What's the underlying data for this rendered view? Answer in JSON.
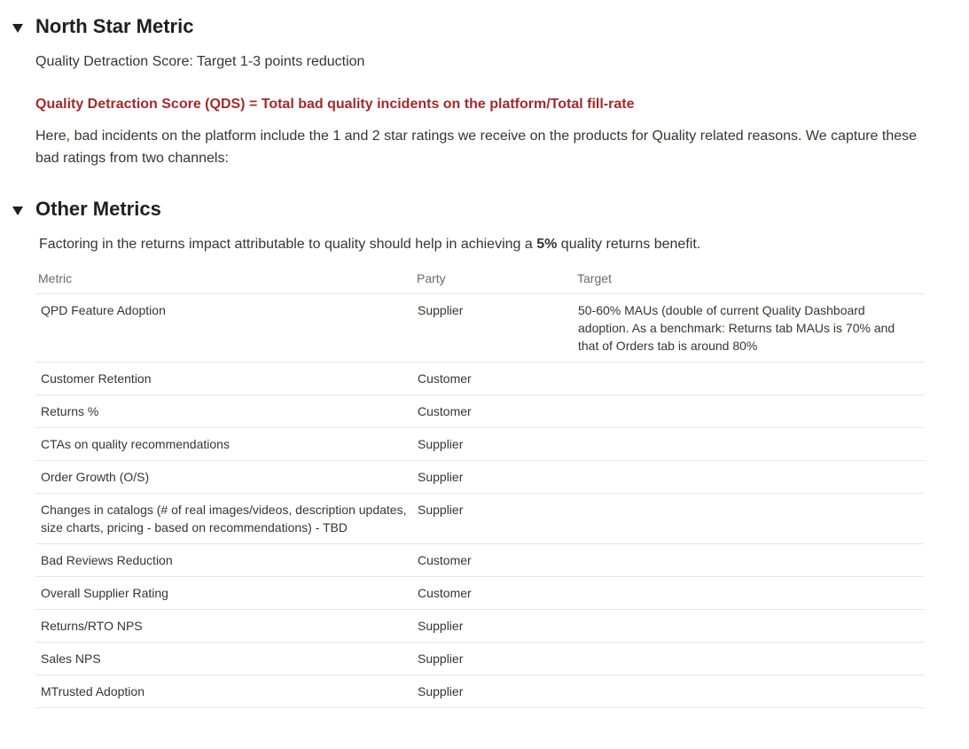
{
  "north_star": {
    "heading": "North Star Metric",
    "subtitle": "Quality Detraction Score: Target 1-3 points reduction",
    "formula": "Quality Detraction Score (QDS) = Total bad quality incidents on the platform/Total fill-rate",
    "description": "Here, bad incidents on the platform include the 1 and 2 star ratings we receive on the products for Quality related reasons. We capture these bad ratings from two channels:",
    "accent_color": "#9f2b2b"
  },
  "other_metrics": {
    "heading": "Other Metrics",
    "intro_prefix": "Factoring in the returns impact attributable to quality should help in achieving a ",
    "intro_bold": "5%",
    "intro_suffix": " quality returns benefit.",
    "table": {
      "headers": {
        "metric": "Metric",
        "party": "Party",
        "target": "Target"
      },
      "rows": [
        {
          "metric": "QPD Feature Adoption",
          "party": "Supplier",
          "target": "50-60% MAUs (double of current Quality Dashboard adoption. As a benchmark: Returns tab MAUs is 70% and that of Orders tab is around 80%"
        },
        {
          "metric": "Customer Retention",
          "party": "Customer",
          "target": ""
        },
        {
          "metric": "Returns %",
          "party": "Customer",
          "target": ""
        },
        {
          "metric": "CTAs on quality recommendations",
          "party": "Supplier",
          "target": ""
        },
        {
          "metric": "Order Growth (O/S)",
          "party": "Supplier",
          "target": ""
        },
        {
          "metric": "Changes in catalogs (# of real images/videos, description updates, size charts, pricing - based on recommendations) - TBD",
          "party": "Supplier",
          "target": ""
        },
        {
          "metric": "Bad Reviews Reduction",
          "party": "Customer",
          "target": ""
        },
        {
          "metric": "Overall Supplier Rating",
          "party": "Customer",
          "target": ""
        },
        {
          "metric": "Returns/RTO NPS",
          "party": "Supplier",
          "target": ""
        },
        {
          "metric": "Sales NPS",
          "party": "Supplier",
          "target": ""
        },
        {
          "metric": "MTrusted Adoption",
          "party": "Supplier",
          "target": ""
        }
      ]
    }
  },
  "icons": {
    "toggle": "triangle-down-icon"
  }
}
